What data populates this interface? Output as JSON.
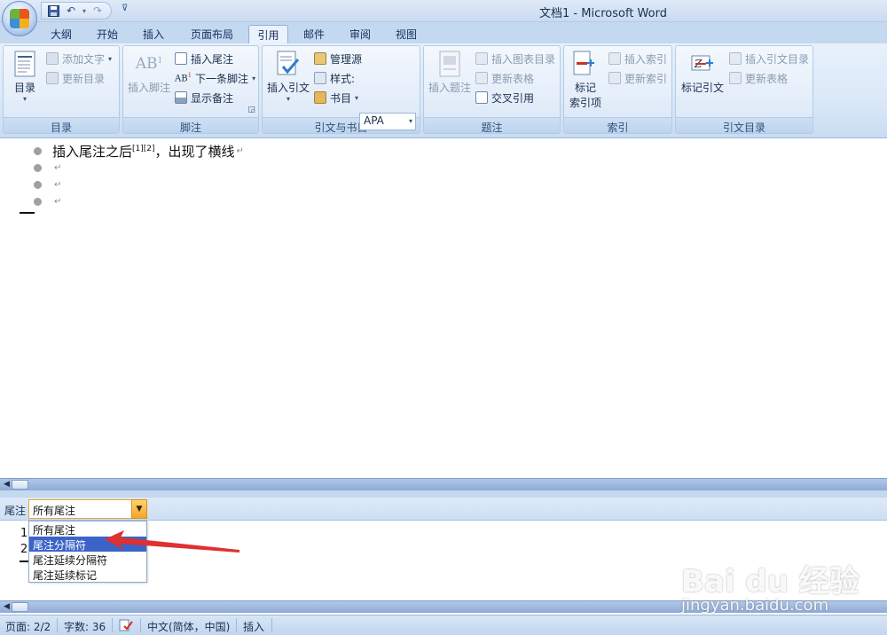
{
  "window": {
    "title": "文档1 - Microsoft Word"
  },
  "quick_access": {
    "icons": [
      "save-icon",
      "undo-icon",
      "redo-icon"
    ]
  },
  "tabs": [
    {
      "label": "大纲",
      "active": false
    },
    {
      "label": "开始",
      "active": false
    },
    {
      "label": "插入",
      "active": false
    },
    {
      "label": "页面布局",
      "active": false
    },
    {
      "label": "引用",
      "active": true
    },
    {
      "label": "邮件",
      "active": false
    },
    {
      "label": "审阅",
      "active": false
    },
    {
      "label": "视图",
      "active": false
    }
  ],
  "ribbon": {
    "toc": {
      "label": "目录",
      "big_button": "目录",
      "add_text": "添加文字",
      "update_toc": "更新目录"
    },
    "footnotes": {
      "label": "脚注",
      "insert_footnote": "插入脚注",
      "insert_endnote": "插入尾注",
      "next_footnote": "下一条脚注",
      "show_notes": "显示备注"
    },
    "citations": {
      "label": "引文与书目",
      "insert_citation": "插入引文",
      "manage_sources": "管理源",
      "style_label": "样式:",
      "style_value": "APA",
      "bibliography": "书目"
    },
    "captions": {
      "label": "题注",
      "insert_caption": "插入题注",
      "insert_table_of_figures": "插入图表目录",
      "update_table": "更新表格",
      "cross_reference": "交叉引用"
    },
    "index": {
      "label": "索引",
      "mark_entry_line1": "标记",
      "mark_entry_line2": "索引项",
      "insert_index": "插入索引",
      "update_index": "更新索引"
    },
    "authorities": {
      "label": "引文目录",
      "mark_citation": "标记引文",
      "insert_toa": "插入引文目录",
      "update_table": "更新表格"
    }
  },
  "document": {
    "first_line": "插入尾注之后",
    "sup": "[1][2]",
    "first_line_rest": "，出现了横线",
    "para_mark": "↵"
  },
  "endnotes": {
    "label": "尾注",
    "selected": "所有尾注",
    "options": [
      "所有尾注",
      "尾注分隔符",
      "尾注延续分隔符",
      "尾注延续标记"
    ],
    "highlighted_index": 1,
    "numbers": [
      "1",
      "2"
    ]
  },
  "statusbar": {
    "page": "页面: 2/2",
    "words": "字数: 36",
    "language": "中文(简体，中国)",
    "mode": "插入"
  },
  "watermark": {
    "brand": "Bai du 经验",
    "url": "jingyan.baidu.com"
  },
  "colors": {
    "accent": "#c4d8f0",
    "highlight": "#3c64c8",
    "arrow": "#e03030"
  }
}
